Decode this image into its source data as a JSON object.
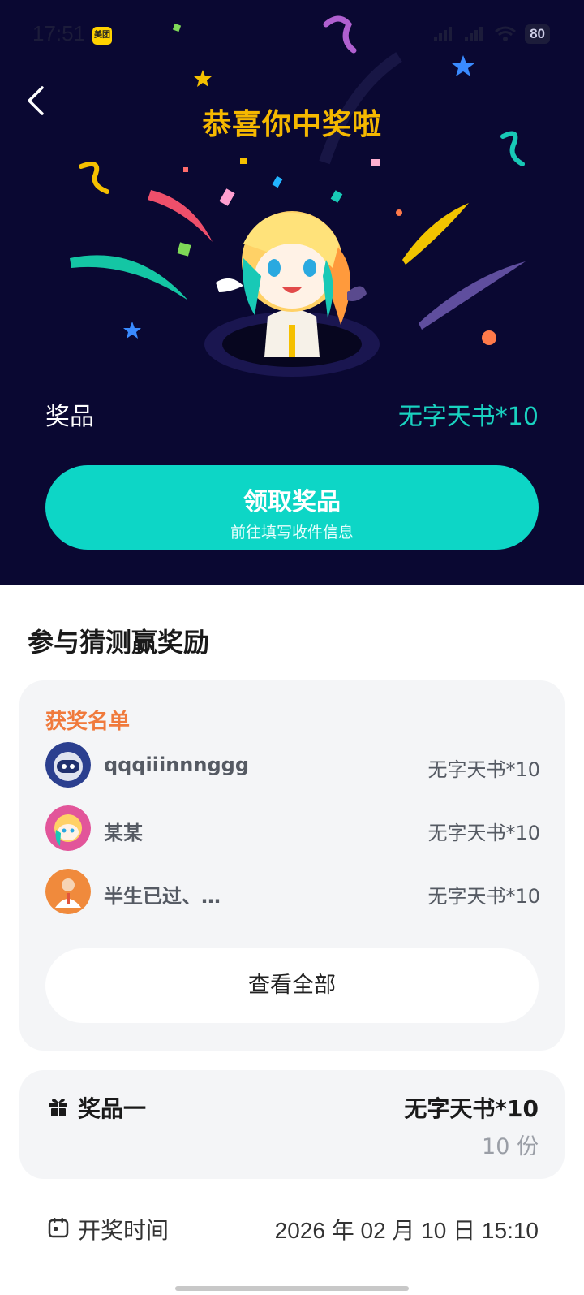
{
  "status_bar": {
    "time": "17:51",
    "app_badge": "美团",
    "battery": "80"
  },
  "hero": {
    "title": "恭喜你中奖啦",
    "prize_label": "奖品",
    "prize_value": "无字天书*10",
    "claim_button": {
      "label": "领取奖品",
      "sublabel": "前往填写收件信息"
    }
  },
  "section": {
    "title": "参与猜测赢奖励"
  },
  "winners": {
    "heading": "获奖名单",
    "rows": [
      {
        "name": "qqqiiinnnggg",
        "prize": "无字天书*10"
      },
      {
        "name": "某某",
        "prize": "无字天书*10"
      },
      {
        "name": "半生已过、…",
        "prize": "无字天书*10"
      }
    ],
    "view_all": "查看全部"
  },
  "prize_item": {
    "label": "奖品一",
    "name": "无字天书*10",
    "quantity": "10 份"
  },
  "draw_time": {
    "label": "开奖时间",
    "value": "2026 年 02 月 10 日 15:10"
  },
  "colors": {
    "hero_bg": "#0a0832",
    "title_gold": "#f5b800",
    "accent_teal": "#0dd6c6",
    "winners_orange": "#f07a3c"
  }
}
